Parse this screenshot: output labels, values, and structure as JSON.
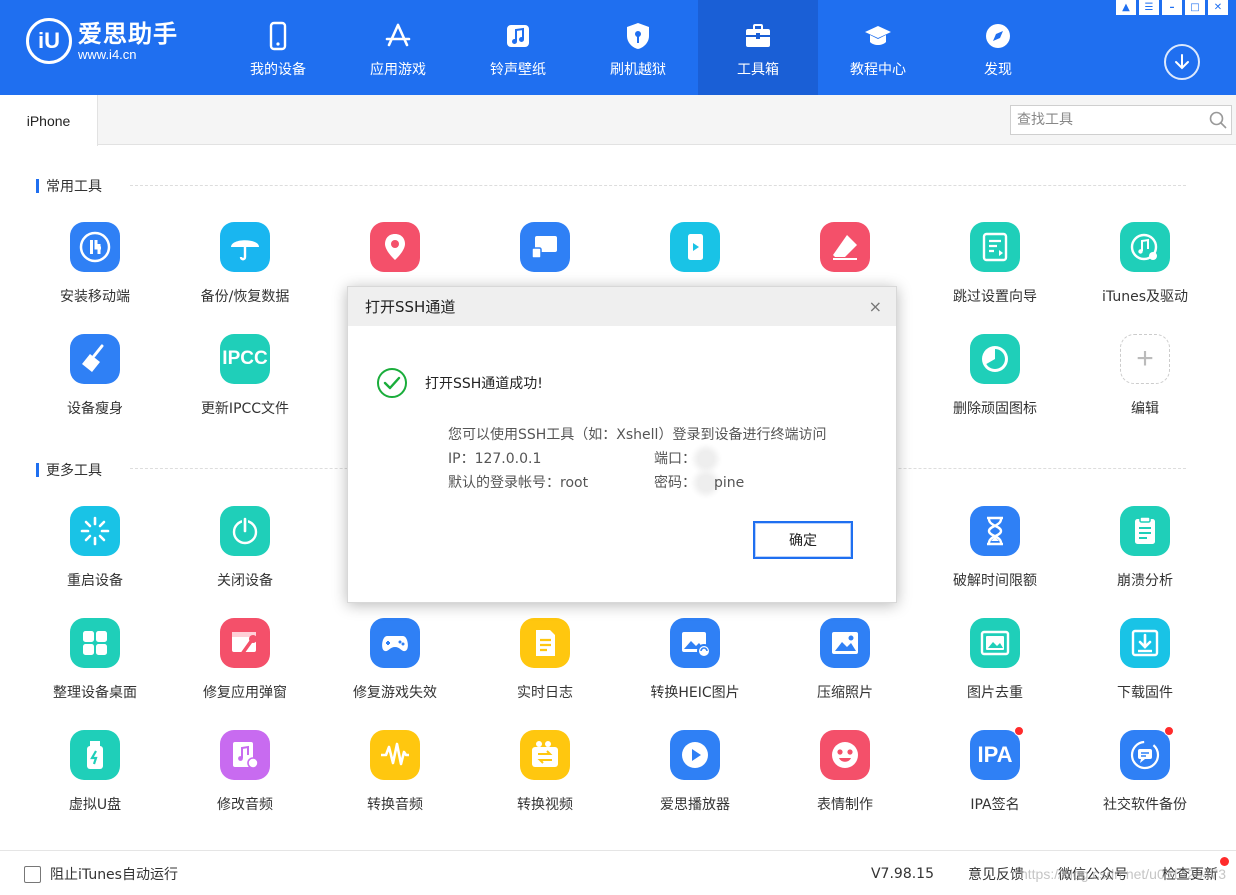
{
  "app": {
    "logo_badge": "iU",
    "logo_name": "爱思助手",
    "logo_url": "www.i4.cn"
  },
  "nav": [
    {
      "label": "我的设备",
      "icon": "phone-icon"
    },
    {
      "label": "应用游戏",
      "icon": "app-store-icon"
    },
    {
      "label": "铃声壁纸",
      "icon": "music-note-icon"
    },
    {
      "label": "刷机越狱",
      "icon": "shield-key-icon"
    },
    {
      "label": "工具箱",
      "icon": "toolbox-icon",
      "active": true
    },
    {
      "label": "教程中心",
      "icon": "graduation-cap-icon"
    },
    {
      "label": "发现",
      "icon": "compass-icon"
    }
  ],
  "window_controls": [
    "shirt-icon",
    "menu-icon",
    "minimize-icon",
    "maximize-icon",
    "close-icon"
  ],
  "tabbar": {
    "tab": "iPhone",
    "search_placeholder": "查找工具"
  },
  "sections": {
    "common": "常用工具",
    "more": "更多工具"
  },
  "common_tools": [
    {
      "label": "安装移动端",
      "icon": "i4-logo-icon",
      "color": "#2f80f5"
    },
    {
      "label": "备份/恢复数据",
      "icon": "umbrella-icon",
      "color": "#19b6f0"
    },
    {
      "label": "",
      "icon": "location-pin-icon",
      "color": "#f4506a"
    },
    {
      "label": "",
      "icon": "screen-mirror-icon",
      "color": "#2f80f5"
    },
    {
      "label": "",
      "icon": "phone-screen-icon",
      "color": "#19c3e6"
    },
    {
      "label": "",
      "icon": "eraser-icon",
      "color": "#f4506a"
    },
    {
      "label": "跳过设置向导",
      "icon": "skip-setup-icon",
      "color": "#1fcfb9"
    },
    {
      "label": "iTunes及驱动",
      "icon": "itunes-icon",
      "color": "#1fcfb9"
    },
    {
      "label": "设备瘦身",
      "icon": "broom-icon",
      "color": "#2f80f5"
    },
    {
      "label": "更新IPCC文件",
      "icon": "ipcc-icon",
      "text": "IPCC",
      "color": "#1fcfb9"
    },
    {
      "label": "",
      "icon": "",
      "color": ""
    },
    {
      "label": "",
      "icon": "",
      "color": ""
    },
    {
      "label": "",
      "icon": "",
      "color": ""
    },
    {
      "label": "",
      "icon": "",
      "color": ""
    },
    {
      "label": "删除顽固图标",
      "icon": "pie-clock-icon",
      "color": "#1fcfb9"
    },
    {
      "label": "编辑",
      "icon": "add-icon",
      "color": "add"
    }
  ],
  "more_tools": [
    {
      "label": "重启设备",
      "icon": "restart-icon",
      "color": "#19c3e6"
    },
    {
      "label": "关闭设备",
      "icon": "power-icon",
      "color": "#1fcfb9"
    },
    {
      "label": "",
      "icon": "",
      "color": ""
    },
    {
      "label": "",
      "icon": "",
      "color": ""
    },
    {
      "label": "",
      "icon": "",
      "color": ""
    },
    {
      "label": "",
      "icon": "",
      "color": ""
    },
    {
      "label": "破解时间限额",
      "icon": "hourglass-icon",
      "color": "#2f80f5"
    },
    {
      "label": "崩溃分析",
      "icon": "report-icon",
      "color": "#1fcfb9"
    },
    {
      "label": "整理设备桌面",
      "icon": "grid-icon",
      "color": "#1fcfb9"
    },
    {
      "label": "修复应用弹窗",
      "icon": "wrench-icon",
      "color": "#f4506a"
    },
    {
      "label": "修复游戏失效",
      "icon": "gamepad-icon",
      "color": "#2f80f5"
    },
    {
      "label": "实时日志",
      "icon": "log-icon",
      "color": "#ffc70f"
    },
    {
      "label": "转换HEIC图片",
      "icon": "heic-convert-icon",
      "color": "#2f80f5"
    },
    {
      "label": "压缩照片",
      "icon": "photo-icon",
      "color": "#2f80f5"
    },
    {
      "label": "图片去重",
      "icon": "dedupe-photo-icon",
      "color": "#1fcfb9"
    },
    {
      "label": "下载固件",
      "icon": "download-firmware-icon",
      "color": "#19c3e6"
    },
    {
      "label": "虚拟U盘",
      "icon": "usb-drive-icon",
      "color": "#1fcfb9"
    },
    {
      "label": "修改音频",
      "icon": "audio-edit-icon",
      "color": "#c86bf0"
    },
    {
      "label": "转换音频",
      "icon": "waveform-icon",
      "color": "#ffc70f"
    },
    {
      "label": "转换视频",
      "icon": "video-convert-icon",
      "color": "#ffc70f"
    },
    {
      "label": "爱思播放器",
      "icon": "play-icon",
      "color": "#2f80f5"
    },
    {
      "label": "表情制作",
      "icon": "emoji-icon",
      "color": "#f4506a"
    },
    {
      "label": "IPA签名",
      "icon": "ipa-icon",
      "text": "IPA",
      "color": "#2f80f5",
      "badge": true
    },
    {
      "label": "社交软件备份",
      "icon": "chat-backup-icon",
      "color": "#2f80f5",
      "badge": true
    }
  ],
  "footer": {
    "checkbox_label": "阻止iTunes自动运行",
    "version": "V7.98.15",
    "feedback": "意见反馈",
    "wechat": "微信公众号",
    "update": "检查更新",
    "watermark": "https://blog.csdn.net/u011426473"
  },
  "dialog": {
    "title": "打开SSH通道",
    "close": "×",
    "success": "打开SSH通道成功!",
    "hint": "您可以使用SSH工具（如：Xshell）登录到设备进行终端访问",
    "ip": "IP：127.0.0.1",
    "port_label": "端口：",
    "account": "默认的登录帐号：root",
    "password_label": "密码：",
    "password_suffix": "pine",
    "ok": "确定"
  }
}
